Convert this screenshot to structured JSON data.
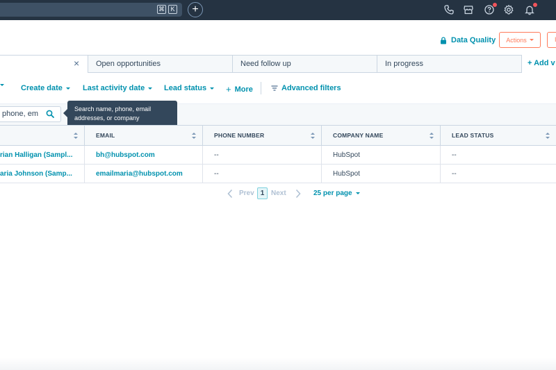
{
  "topbar": {
    "shortcut_cmd": "⌘",
    "shortcut_key": "K",
    "new_tab": "+",
    "icons": [
      "phone-icon",
      "marketplace-icon",
      "help-icon",
      "settings-icon",
      "notifications-icon"
    ],
    "background": "#253342",
    "notification_color": "#f2545b"
  },
  "header": {
    "data_quality": "Data Quality",
    "actions": "Actions",
    "next_button": "I"
  },
  "tabs": [
    {
      "label": ""
    },
    {
      "label": "Open opportunities"
    },
    {
      "label": "Need follow up"
    },
    {
      "label": "In progress"
    }
  ],
  "add_view": "+ Add v",
  "filters": {
    "create_date": "Create date",
    "last_activity_date": "Last activity date",
    "lead_status": "Lead status",
    "more": "More",
    "advanced_filters": "Advanced filters"
  },
  "search": {
    "placeholder": "phone, em",
    "tooltip_line1": "Search name, phone, email",
    "tooltip_line2": "addresses, or company"
  },
  "table": {
    "columns": [
      "",
      "EMAIL",
      "PHONE NUMBER",
      "COMPANY NAME",
      "LEAD STATUS"
    ],
    "rows": [
      {
        "name": "rian Halligan (Sampl...",
        "email": "bh@hubspot.com",
        "phone": "--",
        "company": "HubSpot",
        "lead_status": "--"
      },
      {
        "name": "aria Johnson (Samp...",
        "email": "emailmaria@hubspot.com",
        "phone": "--",
        "company": "HubSpot",
        "lead_status": "--"
      }
    ]
  },
  "pagination": {
    "prev": "Prev",
    "current_page": "1",
    "next": "Next",
    "per_page": "25 per page"
  },
  "colors": {
    "accent": "#0091ae",
    "action": "#ff7a59",
    "text": "#33475b"
  }
}
